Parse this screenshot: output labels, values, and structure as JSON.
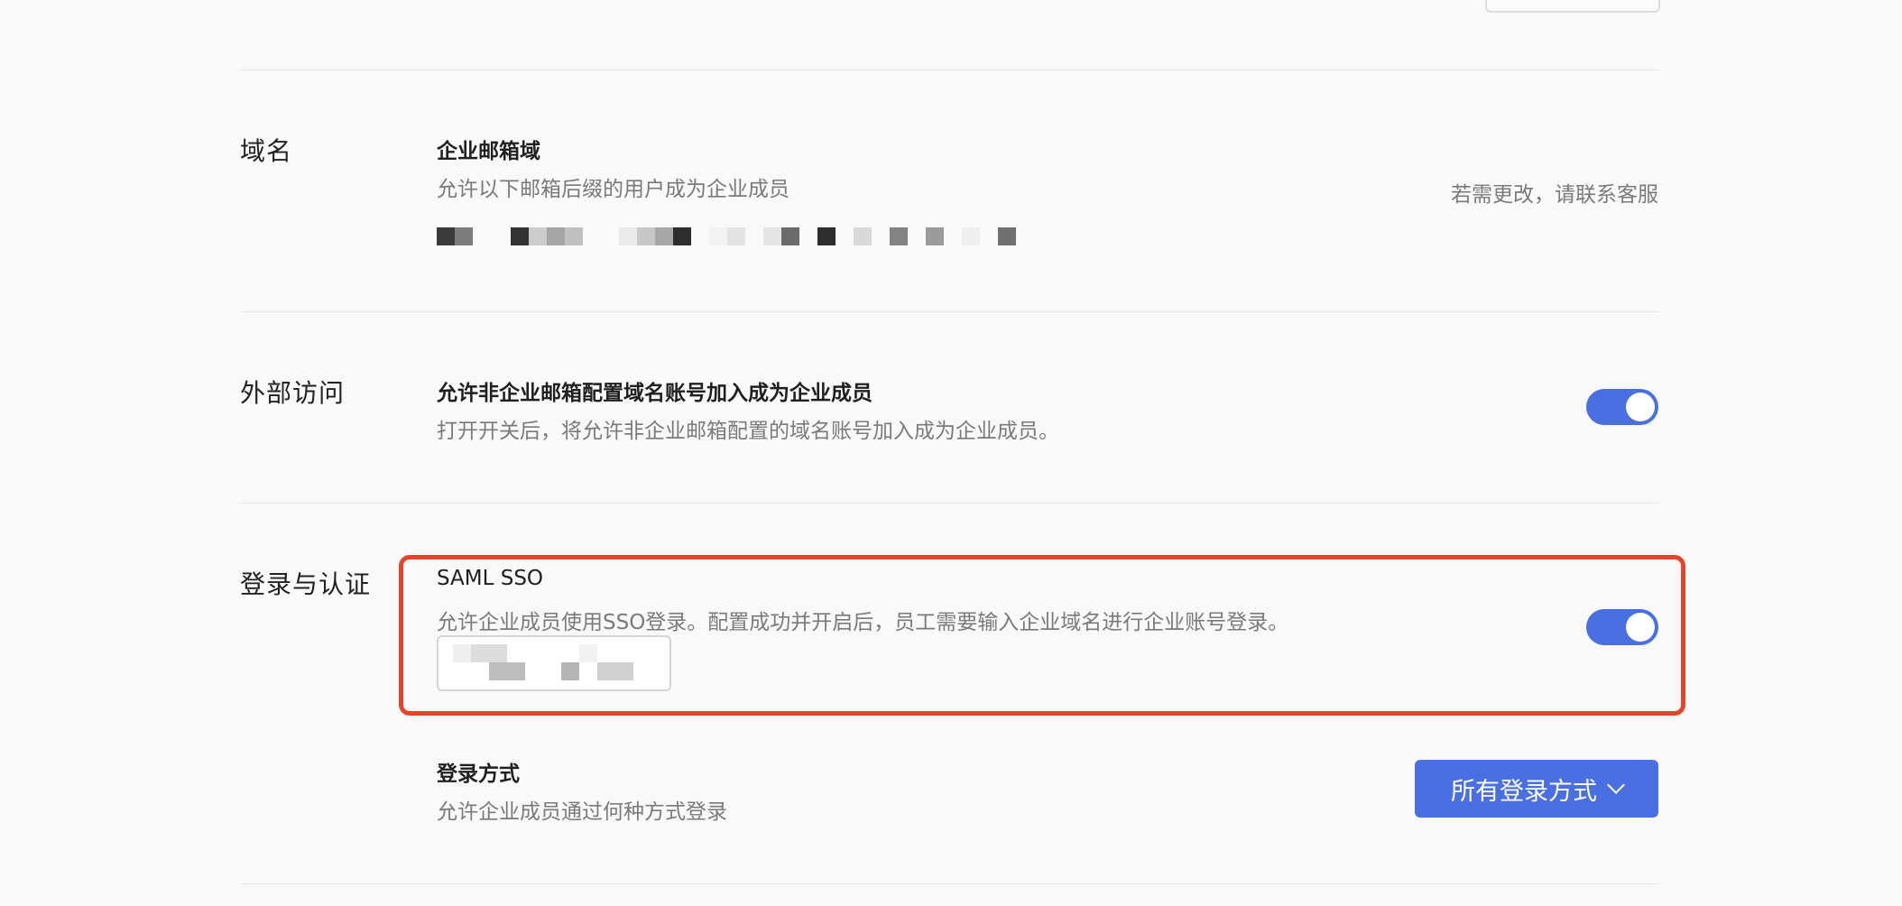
{
  "sections": {
    "domain": {
      "label": "域名",
      "title": "企业邮箱域",
      "desc": "允许以下邮箱后缀的用户成为企业成员",
      "note": "若需更改，请联系客服"
    },
    "external": {
      "label": "外部访问",
      "title": "允许非企业邮箱配置域名账号加入成为企业成员",
      "desc": "打开开关后，将允许非企业邮箱配置的域名账号加入成为企业成员。",
      "toggle_on": true
    },
    "auth": {
      "label": "登录与认证",
      "sso": {
        "title": "SAML SSO",
        "desc": "允许企业成员使用SSO登录。配置成功并开启后，员工需要输入企业域名进行企业账号登录。",
        "toggle_on": true
      },
      "login_method": {
        "title": "登录方式",
        "desc": "允许企业成员通过何种方式登录",
        "button_label": "所有登录方式"
      }
    }
  },
  "colors": {
    "accent": "#4a6fe3",
    "highlight": "#e2452c",
    "background": "#f9f9f9"
  },
  "icons": {
    "dropdown": "chevron-down-icon"
  }
}
